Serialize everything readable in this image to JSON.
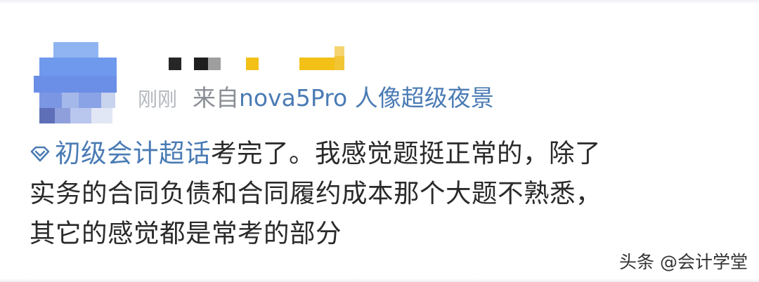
{
  "post": {
    "time": "刚刚",
    "source_prefix": "来自",
    "device": "nova5Pro 人像超级夜景",
    "topic": "初级会计超话",
    "text_line1": "考完了。我感觉题挺正常的，除了",
    "text_line2": "实务的合同负债和合同履约成本那个大题不熟悉，",
    "text_line3": "其它的感觉都是常考的部分"
  },
  "icons": {
    "topic": "diamond-topic-icon"
  },
  "colors": {
    "link_blue": "#4a7bb4",
    "body_text": "#2a2a2a",
    "meta_gray": "#8b8f95"
  },
  "watermark": {
    "text": "头条 @会计学堂"
  }
}
